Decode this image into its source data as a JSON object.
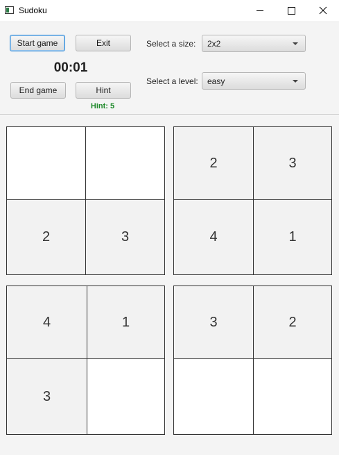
{
  "window": {
    "title": "Sudoku"
  },
  "icons": {
    "app": "sudoku-app-icon",
    "minimize": "minimize-icon",
    "maximize": "maximize-icon",
    "close": "close-icon"
  },
  "controls": {
    "start_label": "Start game",
    "exit_label": "Exit",
    "end_label": "End game",
    "hint_label": "Hint",
    "timer": "00:01",
    "hint_count": "Hint: 5",
    "size_label": "Select a size:",
    "size_value": "2x2",
    "level_label": "Select a level:",
    "level_value": "easy"
  },
  "colors": {
    "hint_text": "#1f8a2b",
    "focus_border": "#3a8fd8"
  },
  "board": {
    "blocks": [
      {
        "cells": [
          "",
          "",
          "2",
          "3"
        ]
      },
      {
        "cells": [
          "2",
          "3",
          "4",
          "1"
        ]
      },
      {
        "cells": [
          "4",
          "1",
          "3",
          ""
        ]
      },
      {
        "cells": [
          "3",
          "2",
          "",
          ""
        ]
      }
    ]
  }
}
